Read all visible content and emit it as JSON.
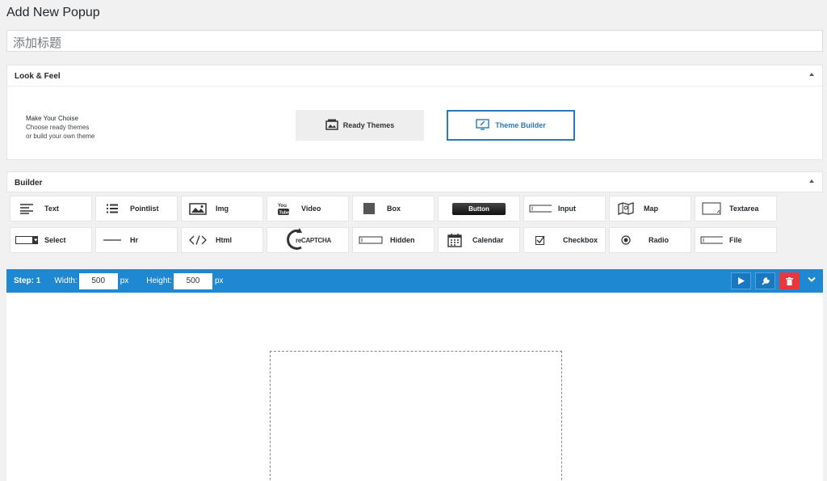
{
  "page": {
    "title": "Add New Popup",
    "title_placeholder": "添加标题"
  },
  "look_feel": {
    "header": "Look & Feel",
    "choise_heading": "Make Your Choise",
    "choise_line1": "Choose ready themes",
    "choise_line2": "or build your own theme",
    "ready_themes": "Ready Themes",
    "theme_builder": "Theme Builder"
  },
  "builder": {
    "header": "Builder",
    "tools": [
      {
        "label": "Text",
        "icon": "text-align-icon"
      },
      {
        "label": "Pointlist",
        "icon": "list-icon"
      },
      {
        "label": "Img",
        "icon": "image-icon"
      },
      {
        "label": "Video",
        "icon": "youtube-icon"
      },
      {
        "label": "Box",
        "icon": "box-icon"
      },
      {
        "label": "Button",
        "icon": "button-icon"
      },
      {
        "label": "Input",
        "icon": "input-icon"
      },
      {
        "label": "Map",
        "icon": "map-icon"
      },
      {
        "label": "Textarea",
        "icon": "textarea-icon"
      },
      {
        "label": "Select",
        "icon": "select-icon"
      },
      {
        "label": "Hr",
        "icon": "hr-icon"
      },
      {
        "label": "Html",
        "icon": "code-icon"
      },
      {
        "label": "reCAPTCHA",
        "icon": "recaptcha-icon"
      },
      {
        "label": "Hidden",
        "icon": "hidden-input-icon"
      },
      {
        "label": "Calendar",
        "icon": "calendar-icon"
      },
      {
        "label": "Checkbox",
        "icon": "checkbox-icon"
      },
      {
        "label": "Radio",
        "icon": "radio-icon"
      },
      {
        "label": "File",
        "icon": "file-input-icon"
      }
    ]
  },
  "step": {
    "label": "Step: 1",
    "width_label": "Width:",
    "width_value": "500",
    "height_label": "Height:",
    "height_value": "500",
    "unit": "px"
  },
  "colors": {
    "step_bar": "#1e88d2",
    "delete": "#e8383d",
    "accent": "#2b78b4"
  }
}
